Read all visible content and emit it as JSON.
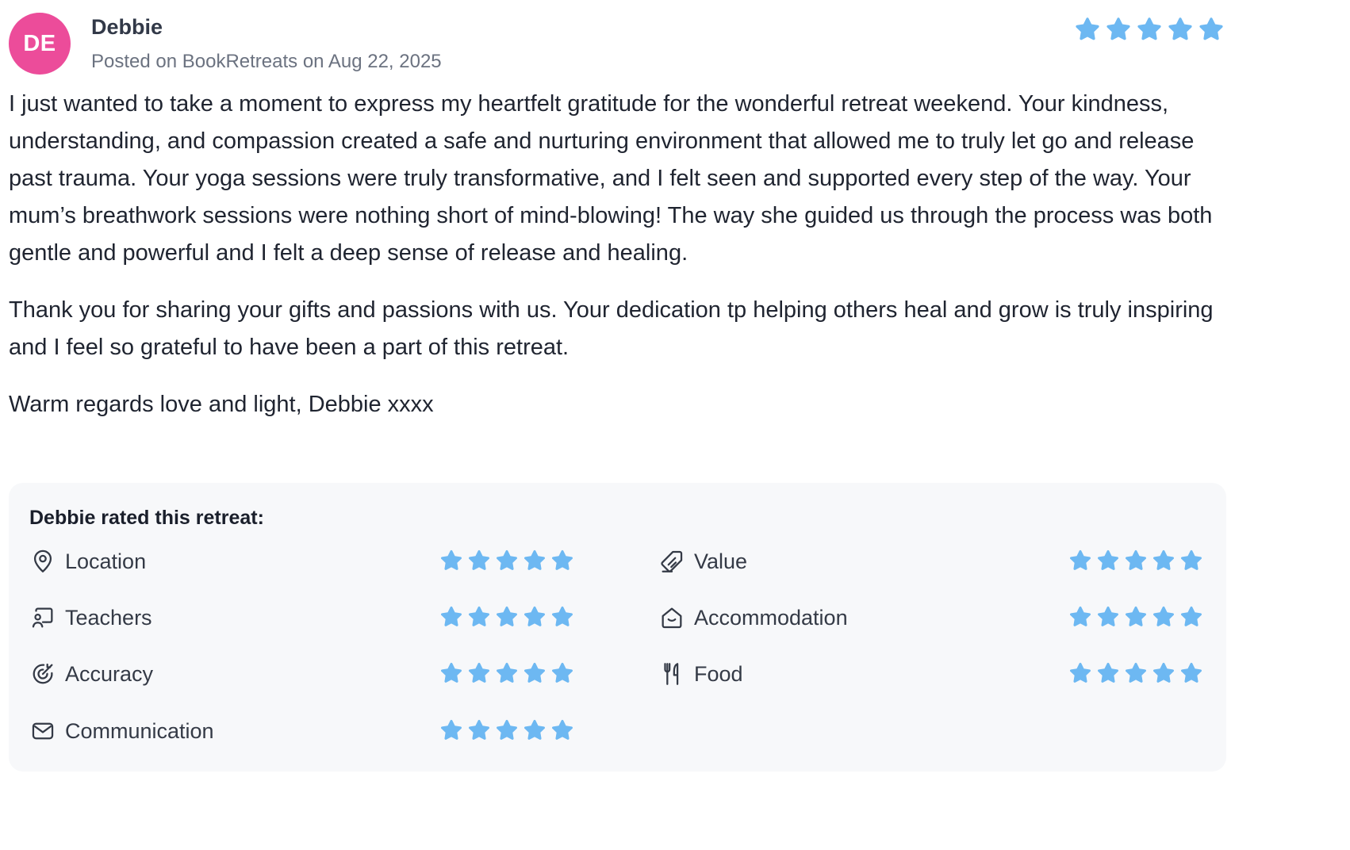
{
  "review": {
    "avatar_initials": "DE",
    "avatar_color": "#ec4c9a",
    "reviewer_name": "Debbie",
    "posted_on": "Posted on BookRetreats on Aug 22, 2025",
    "overall_rating": 5,
    "max_rating": 5,
    "star_color": "#6db8f2",
    "paragraphs": [
      "I just wanted to take a moment to express my heartfelt gratitude for the wonderful retreat weekend. Your kindness, understanding, and compassion created a safe and nurturing environment that allowed me to truly let go and release past trauma. Your yoga sessions were truly transformative, and I felt seen and supported every step of the way. Your mum’s breathwork sessions were nothing short of mind-blowing! The way she guided us through the process was both gentle and powerful and I felt a deep sense of release and healing.",
      "Thank you for sharing your gifts and passions with us. Your dedication tp helping others heal and grow is truly inspiring and I feel so grateful to have been a part of this retreat.",
      "Warm regards love and light, Debbie xxxx"
    ]
  },
  "ratings": {
    "title": "Debbie rated this retreat:",
    "left": [
      {
        "label": "Location",
        "icon": "map-pin-icon",
        "stars": 5
      },
      {
        "label": "Teachers",
        "icon": "teacher-board-icon",
        "stars": 5
      },
      {
        "label": "Accuracy",
        "icon": "target-icon",
        "stars": 5
      },
      {
        "label": "Communication",
        "icon": "mail-icon",
        "stars": 5
      }
    ],
    "right": [
      {
        "label": "Value",
        "icon": "price-tag-icon",
        "stars": 5
      },
      {
        "label": "Accommodation",
        "icon": "house-icon",
        "stars": 5
      },
      {
        "label": "Food",
        "icon": "fork-knife-icon",
        "stars": 5
      }
    ]
  }
}
